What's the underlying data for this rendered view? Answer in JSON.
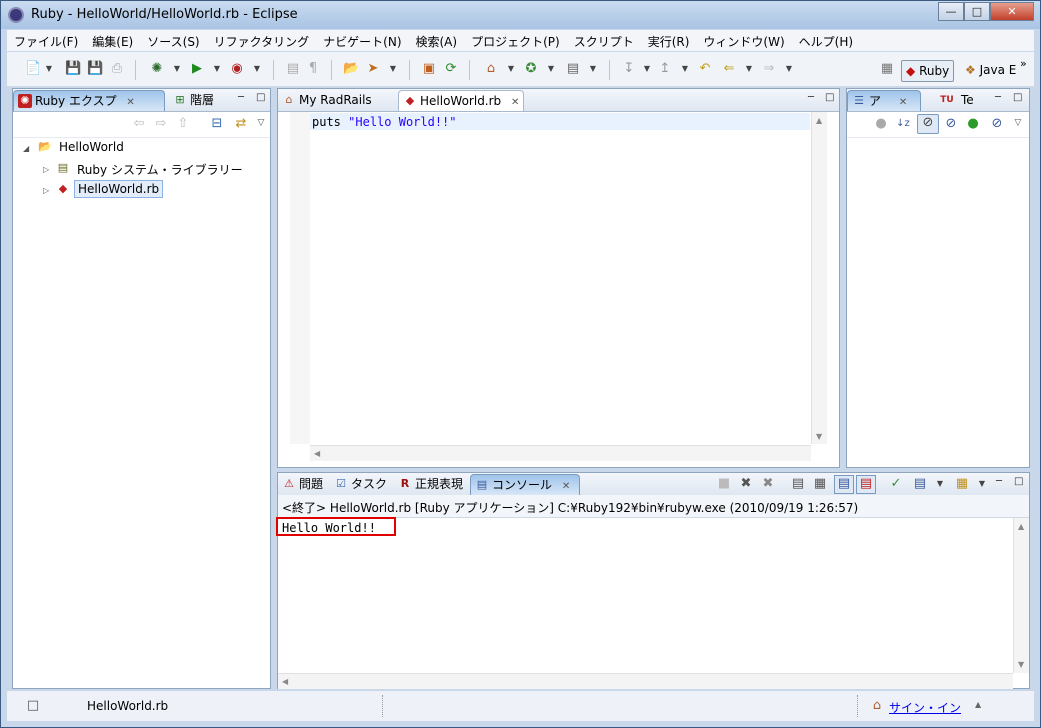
{
  "window": {
    "title": "Ruby - HelloWorld/HelloWorld.rb - Eclipse"
  },
  "menu": [
    "ファイル(F)",
    "編集(E)",
    "ソース(S)",
    "リファクタリング",
    "ナビゲート(N)",
    "検索(A)",
    "プロジェクト(P)",
    "スクリプト",
    "実行(R)",
    "ウィンドウ(W)",
    "ヘルプ(H)"
  ],
  "perspectives": {
    "ruby": "Ruby",
    "java": "Java E",
    "more": "»"
  },
  "left_panel": {
    "tabs": [
      "Ruby エクスプ",
      "階層"
    ],
    "tree": {
      "project": "HelloWorld",
      "library": "Ruby システム・ライブラリー",
      "file": "HelloWorld.rb"
    }
  },
  "editor": {
    "tabs": [
      "My RadRails",
      "HelloWorld.rb"
    ],
    "code": {
      "keyword": "puts",
      "string": "\"Hello World!!\""
    }
  },
  "right_panel": {
    "tabs": [
      "ア",
      "Te"
    ]
  },
  "bottom_panel": {
    "tabs": [
      "問題",
      "タスク",
      "正規表現",
      "コンソール"
    ],
    "console_header": "<終了> HelloWorld.rb [Ruby アプリケーション] C:¥Ruby192¥bin¥rubyw.exe (2010/09/19 1:26:57)",
    "output": "Hello World!!"
  },
  "status": {
    "file": "HelloWorld.rb",
    "sign_in": "サイン・イン"
  },
  "colors": {
    "highlight_box": "#e00000",
    "string_literal": "#2a00ff",
    "active_tab": "#9fc3ea"
  }
}
